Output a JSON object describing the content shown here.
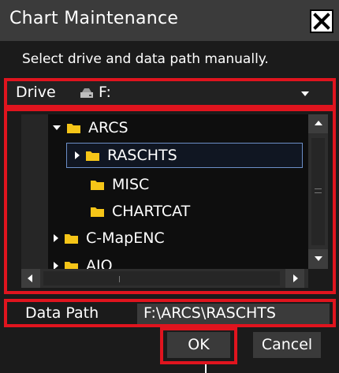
{
  "dialog": {
    "title": "Chart Maintenance",
    "instruction": "Select drive and data path manually."
  },
  "drive": {
    "label": "Drive",
    "value": "F:"
  },
  "tree": {
    "items": [
      {
        "label": "ARCS",
        "expander": "expanded",
        "selected": false
      },
      {
        "label": "RASCHTS",
        "expander": "collapsed",
        "selected": true
      },
      {
        "label": "MISC",
        "expander": "none",
        "selected": false
      },
      {
        "label": "CHARTCAT",
        "expander": "none",
        "selected": false
      },
      {
        "label": "C-MapENC",
        "expander": "collapsed",
        "selected": false
      },
      {
        "label": "AIO",
        "expander": "collapsed",
        "selected": false
      }
    ]
  },
  "data_path": {
    "label": "Data Path",
    "value": "F:\\ARCS\\RASCHTS"
  },
  "buttons": {
    "ok": "OK",
    "cancel": "Cancel"
  },
  "colors": {
    "highlight_frame": "#e0141e",
    "folder": "#f5c518",
    "selection_border": "#6c8fc8"
  }
}
